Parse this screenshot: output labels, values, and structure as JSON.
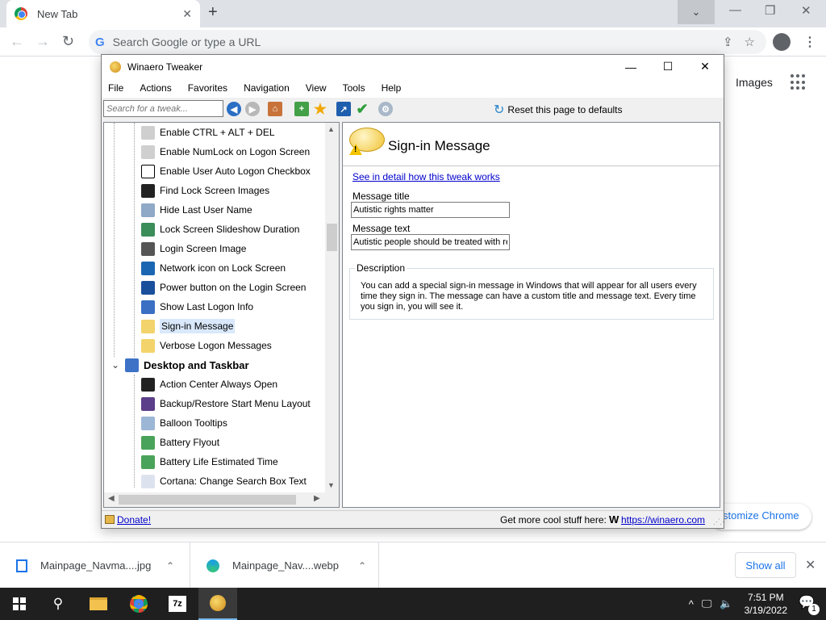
{
  "browser": {
    "tab_title": "New Tab",
    "tab_close": "✕",
    "new_tab": "+",
    "tab_search": "⌄",
    "minimize": "—",
    "restore": "❐",
    "close": "✕",
    "omnibox_placeholder": "Search Google or type a URL",
    "google_g": "G",
    "back": "←",
    "forward": "→",
    "reload": "↻",
    "share": "⇪",
    "star": "☆",
    "menu": "⋮",
    "ntp_images": "Images",
    "ntp_customize": "stomize Chrome"
  },
  "downloads": {
    "items": [
      {
        "name": "Mainpage_Navma....jpg",
        "caret": "⌃"
      },
      {
        "name": "Mainpage_Nav....webp",
        "caret": "⌃"
      }
    ],
    "show_all": "Show all",
    "close": "✕"
  },
  "taskbar": {
    "time": "7:51 PM",
    "date": "3/19/2022",
    "search_icon": "⚲",
    "sevenzip_label": "7z",
    "tray_chevron": "^",
    "tray_network": "🖵",
    "tray_volume": "🔈",
    "notif_icon": "💬",
    "notif_count": "1"
  },
  "app": {
    "title": "Winaero Tweaker",
    "minimize": "—",
    "maximize": "☐",
    "close": "✕",
    "menus": [
      "File",
      "Actions",
      "Favorites",
      "Navigation",
      "View",
      "Tools",
      "Help"
    ],
    "search_placeholder": "Search for a tweak...",
    "reset_label": "Reset this page to defaults",
    "reset_icon": "↻",
    "tree": [
      {
        "label": "Enable CTRL + ALT + DEL",
        "icon": "keyboard-icon",
        "color": "#cfcfcf"
      },
      {
        "label": "Enable NumLock on Logon Screen",
        "icon": "keyboard-icon",
        "color": "#cfcfcf"
      },
      {
        "label": "Enable User Auto Logon Checkbox",
        "icon": "checkbox-icon",
        "color": "#ffffff"
      },
      {
        "label": "Find Lock Screen Images",
        "icon": "image-icon",
        "color": "#222222"
      },
      {
        "label": "Hide Last User Name",
        "icon": "user-icon",
        "color": "#8fa9c7"
      },
      {
        "label": "Lock Screen Slideshow Duration",
        "icon": "slideshow-icon",
        "color": "#3b8d5a"
      },
      {
        "label": "Login Screen Image",
        "icon": "user-circle-icon",
        "color": "#555555"
      },
      {
        "label": "Network icon on Lock Screen",
        "icon": "network-icon",
        "color": "#1a66b3"
      },
      {
        "label": "Power button on the Login Screen",
        "icon": "power-icon",
        "color": "#1a4f9c"
      },
      {
        "label": "Show Last Logon Info",
        "icon": "shield-icon",
        "color": "#3a6fc4"
      },
      {
        "label": "Sign-in Message",
        "icon": "speech-bubble-icon",
        "color": "#f3d36b",
        "selected": true
      },
      {
        "label": "Verbose Logon Messages",
        "icon": "speech-bubble-icon",
        "color": "#f3d36b"
      },
      {
        "label": "Desktop and Taskbar",
        "icon": "desktop-icon",
        "color": "#3d72c7",
        "category": true
      },
      {
        "label": "Action Center Always Open",
        "icon": "action-center-icon",
        "color": "#222222"
      },
      {
        "label": "Backup/Restore Start Menu Layout",
        "icon": "start-menu-icon",
        "color": "#5b3f8a"
      },
      {
        "label": "Balloon Tooltips",
        "icon": "info-icon",
        "color": "#9cb6d6"
      },
      {
        "label": "Battery Flyout",
        "icon": "battery-icon",
        "color": "#4aa35a"
      },
      {
        "label": "Battery Life Estimated Time",
        "icon": "battery-icon",
        "color": "#4aa35a"
      },
      {
        "label": "Cortana: Change Search Box Text",
        "icon": "font-icon",
        "color": "#dde3ee"
      }
    ],
    "pane": {
      "title": "Sign-in Message",
      "detail_link": "See in detail how this tweak works",
      "message_title_label": "Message title",
      "message_title_value": "Autistic rights matter",
      "message_text_label": "Message text",
      "message_text_value": "Autistic people should be treated with res",
      "description_caption": "Description",
      "description_text": "You can add a special sign-in message in Windows that will appear for all users every time they sign in. The message can have a custom title and message text. Every time you sign in, you will see it."
    },
    "status": {
      "donate": "Donate!",
      "more_stuff": "Get more cool stuff here:",
      "w_logo": "W",
      "winaero_link": "https://winaero.com"
    }
  }
}
